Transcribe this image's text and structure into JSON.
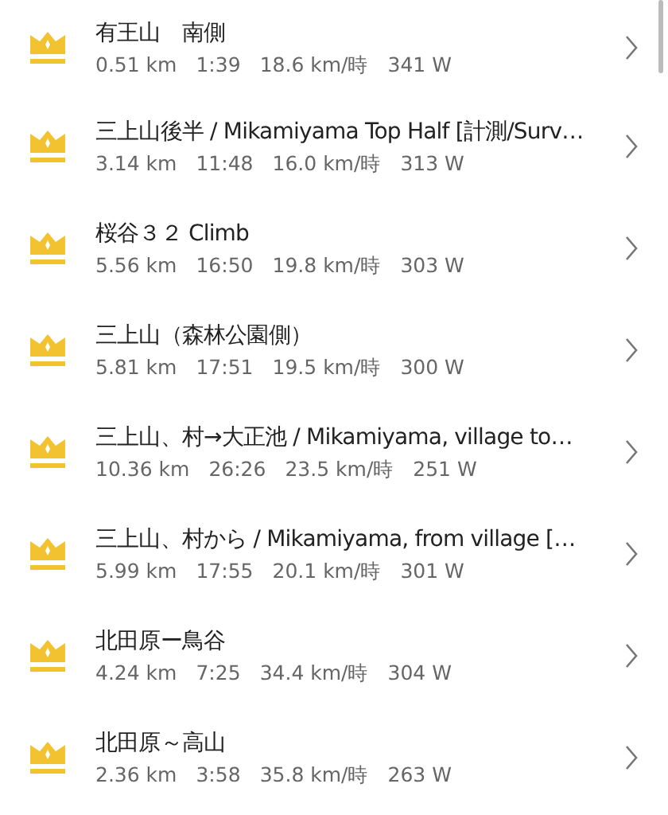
{
  "segments": [
    {
      "name": "有王山　南側",
      "stats": [
        "0.51 km",
        "1:39",
        "18.6 km/時",
        "341 W"
      ]
    },
    {
      "name": "三上山後半 / Mikamiyama Top Half [計測/Surv…",
      "stats": [
        "3.14 km",
        "11:48",
        "16.0 km/時",
        "313 W"
      ]
    },
    {
      "name": "桜谷３２ Climb",
      "stats": [
        "5.56 km",
        "16:50",
        "19.8 km/時",
        "303 W"
      ]
    },
    {
      "name": "三上山（森林公園側）",
      "stats": [
        "5.81 km",
        "17:51",
        "19.5 km/時",
        "300 W"
      ]
    },
    {
      "name": "三上山、村→大正池 / Mikamiyama, village to…",
      "stats": [
        "10.36 km",
        "26:26",
        "23.5 km/時",
        "251 W"
      ]
    },
    {
      "name": "三上山、村から / Mikamiyama, from village […",
      "stats": [
        "5.99 km",
        "17:55",
        "20.1 km/時",
        "301 W"
      ]
    },
    {
      "name": "北田原ー鳥谷",
      "stats": [
        "4.24 km",
        "7:25",
        "34.4 km/時",
        "304 W"
      ]
    },
    {
      "name": "北田原～高山",
      "stats": [
        "2.36 km",
        "3:58",
        "35.8 km/時",
        "263 W"
      ]
    }
  ]
}
